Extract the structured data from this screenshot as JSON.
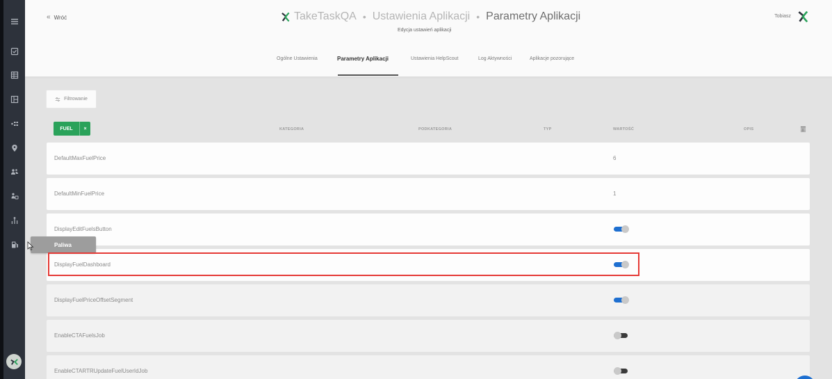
{
  "header": {
    "back_label": "Wróć",
    "title_brand": "TakeTaskQA",
    "title_section": "Ustawienia Aplikacji",
    "title_page": "Parametry Aplikacji",
    "subtitle": "Edycja ustawień aplikacji",
    "user_name": "Tobiasz"
  },
  "tabs": [
    {
      "label": "Ogólne Ustawienia",
      "active": false
    },
    {
      "label": "Parametry Aplikacji",
      "active": true
    },
    {
      "label": "Ustawienia HelpScout",
      "active": false
    },
    {
      "label": "Log Aktywności",
      "active": false
    },
    {
      "label": "Aplikacje pozorujące",
      "active": false
    }
  ],
  "filter": {
    "button_label": "Filtrowanie",
    "active_chip": "FUEL",
    "chip_remove": "×"
  },
  "columns": {
    "category": "KATEGORIA",
    "subcategory": "PODKATEGORIA",
    "type": "TYP",
    "value": "WARTOŚĆ",
    "description": "OPIS"
  },
  "rows": [
    {
      "name": "DefaultMaxFuelPrice",
      "value": "6",
      "kind": "number"
    },
    {
      "name": "DefaultMinFuelPrice",
      "value": "1",
      "kind": "number"
    },
    {
      "name": "DisplayEditFuelsButton",
      "value": "",
      "kind": "toggle",
      "on": true
    },
    {
      "name": "DisplayFuelDashboard",
      "value": "",
      "kind": "toggle",
      "on": true
    },
    {
      "name": "DisplayFuelPriceOffsetSegment",
      "value": "",
      "kind": "toggle",
      "on": true
    },
    {
      "name": "EnableCTAFuelsJob",
      "value": "",
      "kind": "toggle",
      "on": false
    },
    {
      "name": "EnableCTARTRUpdateFuelUserIdJob",
      "value": "",
      "kind": "toggle",
      "on": false
    }
  ],
  "tooltip": "Paliwa",
  "sidebar_icons": [
    "menu-icon",
    "tasks-icon",
    "table-icon",
    "layout-icon",
    "flow-icon",
    "location-icon",
    "users-icon",
    "team-icon",
    "hierarchy-icon",
    "fuel-icon"
  ],
  "colors": {
    "accent_green": "#2aa25a",
    "toggle_on": "#1e6fd0",
    "highlight": "#e53935"
  }
}
